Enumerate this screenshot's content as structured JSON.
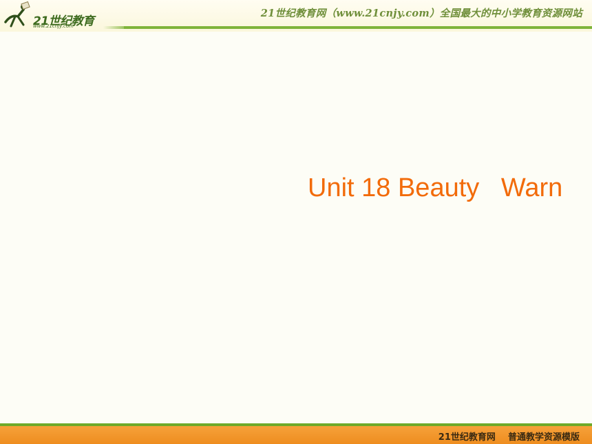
{
  "header": {
    "logo_text": "21世纪教育",
    "logo_url": "www.21cnjy.com",
    "title": "21世纪教育网（www.21cnjy.com）全国最大的中小学教育资源网站"
  },
  "slide": {
    "title": "Unit 18 Beauty   Warn"
  },
  "footer": {
    "text": "21世纪教育网    普通教学资源模版"
  },
  "colors": {
    "accent_orange": "#f26b0a",
    "header_green": "#7fb43a",
    "footer_orange": "#ee8d1f"
  }
}
